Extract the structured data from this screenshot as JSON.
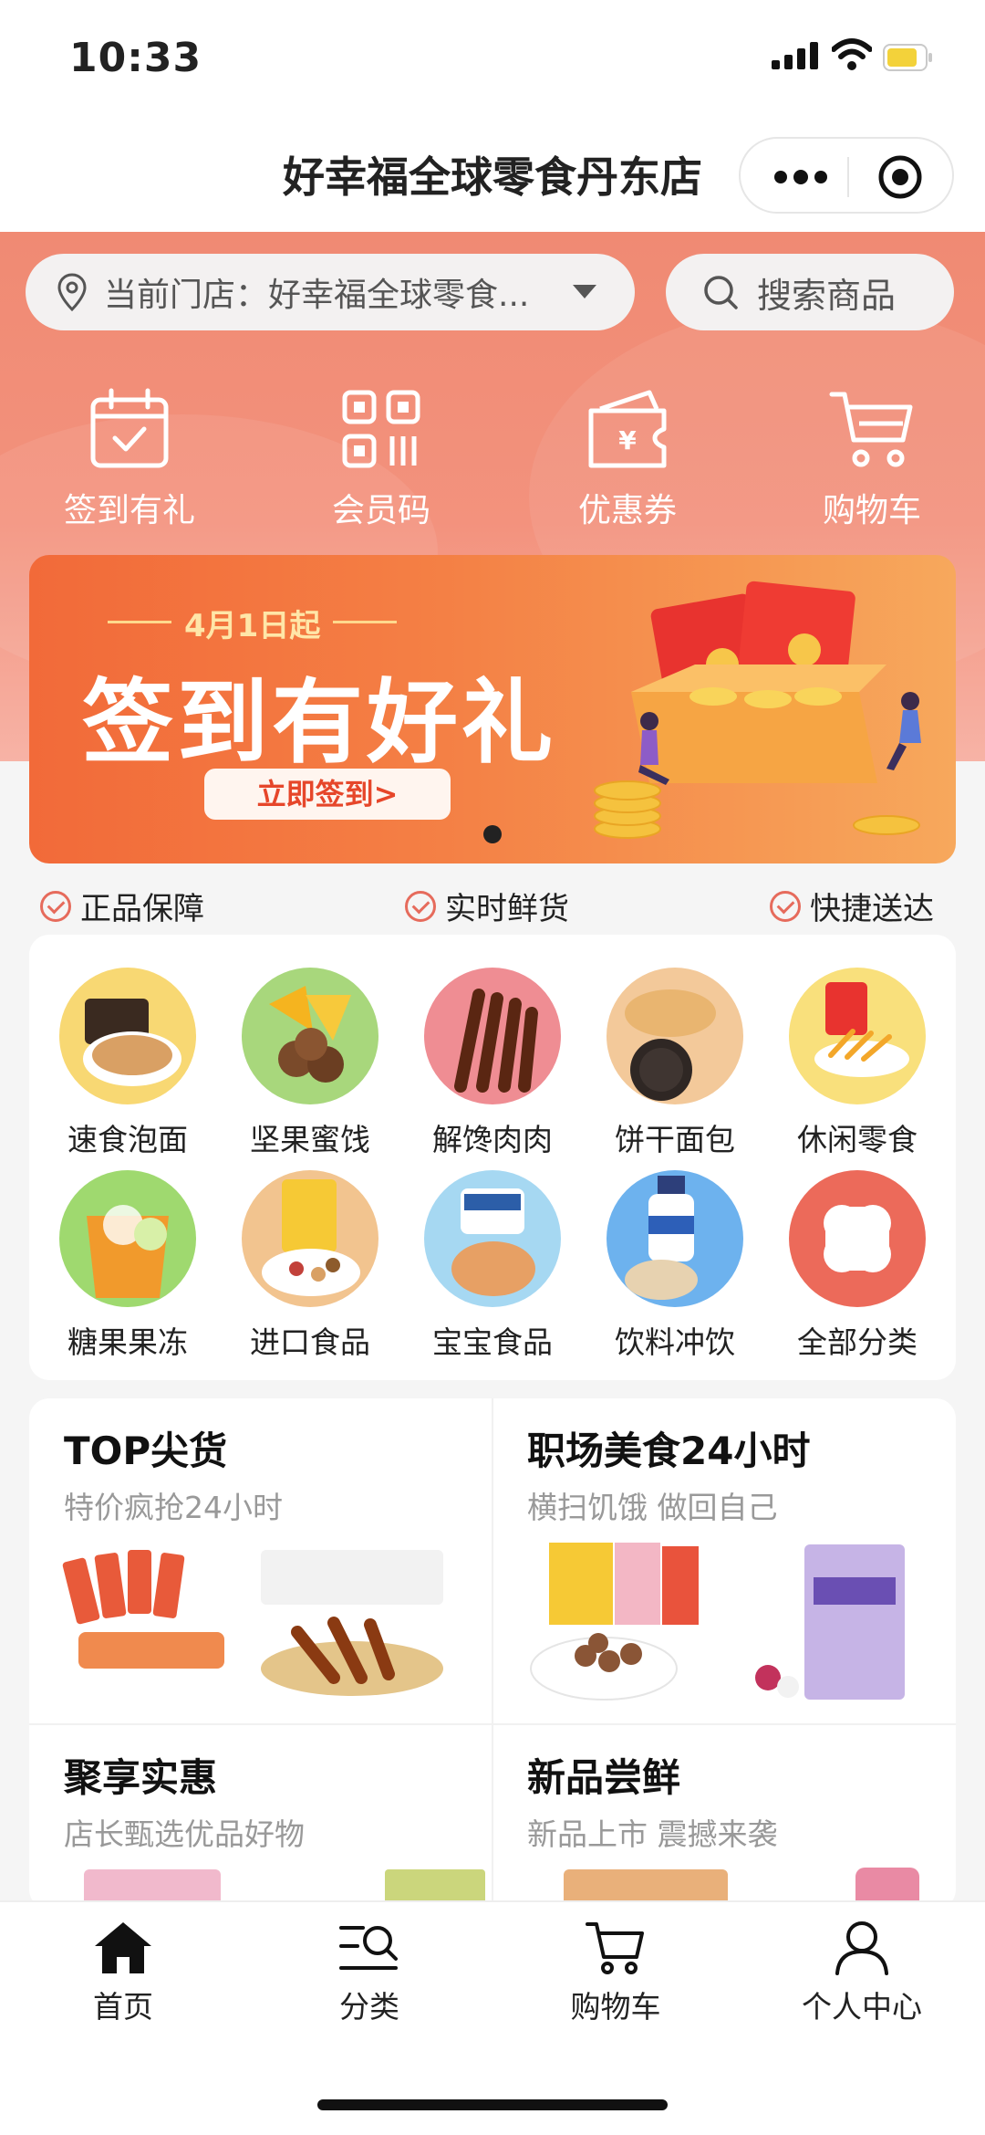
{
  "status_bar": {
    "time": "10:33"
  },
  "app_title": "好幸福全球零食丹东店",
  "store_selector": {
    "label": "当前门店：好幸福全球零食..."
  },
  "search": {
    "label": "搜索商品"
  },
  "quick_actions": [
    {
      "label": "签到有礼",
      "icon": "calendar-check-icon"
    },
    {
      "label": "会员码",
      "icon": "qr-code-icon"
    },
    {
      "label": "优惠券",
      "icon": "coupon-icon"
    },
    {
      "label": "购物车",
      "icon": "cart-icon"
    }
  ],
  "banner": {
    "date": "4月1日起",
    "headline": "签到有好礼",
    "cta": "立即签到>"
  },
  "guarantees": [
    "正品保障",
    "实时鲜货",
    "快捷送达"
  ],
  "categories": [
    {
      "label": "速食泡面",
      "color": "#f8d873"
    },
    {
      "label": "坚果蜜饯",
      "color": "#a8d77c"
    },
    {
      "label": "解馋肉肉",
      "color": "#ef8d93"
    },
    {
      "label": "饼干面包",
      "color": "#f3c99a"
    },
    {
      "label": "休闲零食",
      "color": "#f9e07c"
    },
    {
      "label": "糖果果冻",
      "color": "#9fd96f"
    },
    {
      "label": "进口食品",
      "color": "#f2c48f"
    },
    {
      "label": "宝宝食品",
      "color": "#a6d8f2"
    },
    {
      "label": "饮料冲饮",
      "color": "#6db2ee"
    },
    {
      "label": "全部分类",
      "color": "#ec6a5a"
    }
  ],
  "promos": [
    {
      "title": "TOP尖货",
      "subtitle": "特价疯抢24小时"
    },
    {
      "title": "职场美食24小时",
      "subtitle": "横扫饥饿 做回自己"
    },
    {
      "title": "聚享实惠",
      "subtitle": "店长甄选优品好物"
    },
    {
      "title": "新品尝鲜",
      "subtitle": "新品上市 震撼来袭"
    }
  ],
  "tabs": [
    {
      "label": "首页",
      "icon": "home-icon"
    },
    {
      "label": "分类",
      "icon": "category-search-icon"
    },
    {
      "label": "购物车",
      "icon": "cart-icon"
    },
    {
      "label": "个人中心",
      "icon": "user-icon"
    }
  ],
  "colors": {
    "accent": "#f08a73",
    "banner": "#f26a39",
    "check": "#e66b5c"
  }
}
